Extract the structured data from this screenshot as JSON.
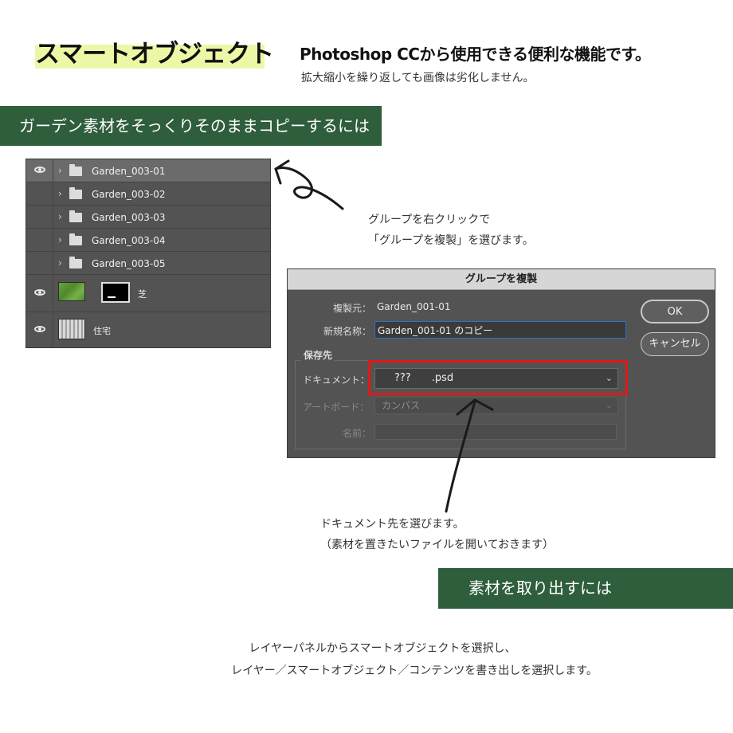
{
  "header": {
    "title": "スマートオブジェクト",
    "intro_line1": "Photoshop CCから使用できる便利な機能です。",
    "intro_line2": "拡大縮小を繰り返しても画像は劣化しません。"
  },
  "section1": {
    "heading": "ガーデン素材をそっくりそのままコピーするには"
  },
  "layers_panel": {
    "folders": [
      {
        "name": "Garden_003-01",
        "visible": true,
        "selected": true
      },
      {
        "name": "Garden_003-02",
        "visible": false,
        "selected": false
      },
      {
        "name": "Garden_003-03",
        "visible": false,
        "selected": false
      },
      {
        "name": "Garden_003-04",
        "visible": false,
        "selected": false
      },
      {
        "name": "Garden_003-05",
        "visible": false,
        "selected": false
      }
    ],
    "grass_layer": {
      "name": "芝",
      "visible": true
    },
    "house_layer": {
      "name": "住宅",
      "visible": true
    }
  },
  "note_right_click": {
    "line1": "グループを右クリックで",
    "line2": "「グループを複製」を選びます。"
  },
  "dialog": {
    "title": "グループを複製",
    "source_label": "複製元：",
    "source_value": "Garden_001-01",
    "new_name_label": "新規名称：",
    "new_name_value": "Garden_001-01 のコピー",
    "destination_label": "保存先",
    "document_label": "ドキュメント：",
    "document_value": "???　　.psd",
    "artboard_label": "アートボード：",
    "artboard_value": "カンバス",
    "name_label": "名前：",
    "name_value": "",
    "ok_label": "OK",
    "cancel_label": "キャンセル"
  },
  "note_document": {
    "line1": "ドキュメント先を選びます。",
    "line2": "（素材を置きたいファイルを開いておきます）"
  },
  "section2": {
    "heading": "素材を取り出すには"
  },
  "note_extract": {
    "line1": "レイヤーパネルからスマートオブジェクトを選択し、",
    "line2": "レイヤー／スマートオブジェクト／コンテンツを書き出しを選択します。"
  },
  "colors": {
    "section_green": "#2f5e3c",
    "title_highlight": "#eef7a6",
    "panel_gray": "#535353",
    "highlight_red": "#e01818"
  }
}
